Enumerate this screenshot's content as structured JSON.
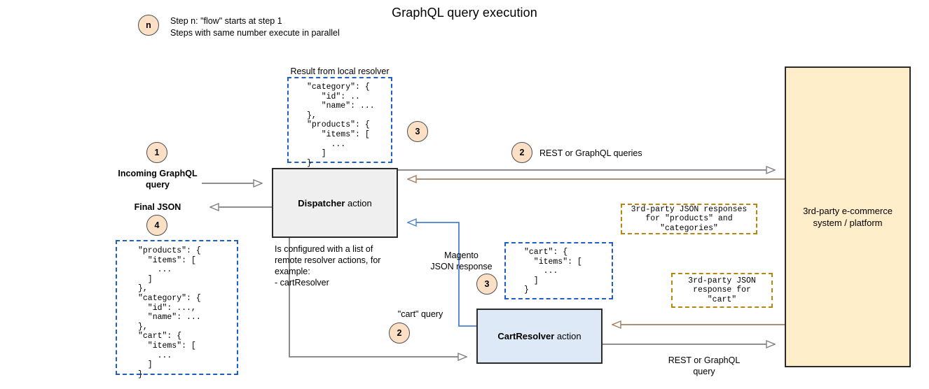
{
  "diagram": {
    "title": "GraphQL query execution",
    "legend": {
      "badge": "n",
      "text": "Step n: \"flow\" starts at step 1\nSteps with same number execute in parallel"
    },
    "nodes": {
      "dispatcher": {
        "name": "Dispatcher",
        "suffix": " action"
      },
      "cart_resolver": {
        "name": "CartResolver",
        "suffix": " action"
      },
      "ecommerce": {
        "text": "3rd-party e-commerce\nsystem / platform"
      }
    },
    "badges": {
      "step1": "1",
      "step2_top": "2",
      "step2_cart": "2",
      "step3_local": "3",
      "step3_magento": "3",
      "step4": "4"
    },
    "json_boxes": {
      "local_resolver": {
        "label": "Result from local resolver",
        "code": "\"category\": {\n   \"id\": ..\n   \"name\": ...\n},\n\"products\": {\n   \"items\": [\n     ...\n   ]\n}"
      },
      "final_json": {
        "code": "\"products\": {\n  \"items\": [\n    ...\n  ]\n},\n\"category\": {\n  \"id\": ...,\n  \"name\": ...\n},\n\"cart\": {\n  \"items\": [\n    ...\n  ]\n}"
      },
      "cart_json": {
        "code": "\"cart\": {\n  \"items\": [\n    ...\n  ]\n}"
      },
      "third_party_top": {
        "code": "3rd-party JSON responses\nfor \"products\" and\n\"categories\""
      },
      "third_party_cart": {
        "code": "3rd-party JSON\nresponse for\n\"cart\""
      }
    },
    "labels": {
      "incoming_query": "Incoming GraphQL\nquery",
      "final_json": "Final JSON",
      "dispatcher_note": "Is configured with a list of\nremote resolver actions, for\nexample:\n- cartResolver",
      "magento_response": "Magento\nJSON response",
      "cart_query": "\"cart\" query",
      "rest_queries_top": "REST or GraphQL queries",
      "rest_query_bottom": "REST or GraphQL\nquery"
    },
    "colors": {
      "badge_fill": "#fbe0c5",
      "dispatcher_fill": "#efefef",
      "cart_resolver_fill": "#dee9f7",
      "ecommerce_fill": "#ffeec9",
      "blue_dash": "#1f5fc4",
      "gold_dash": "#b8860b",
      "gray_wire": "#7f7f7f",
      "brown_wire": "#a08060",
      "blue_wire": "#4b7fd4"
    }
  }
}
